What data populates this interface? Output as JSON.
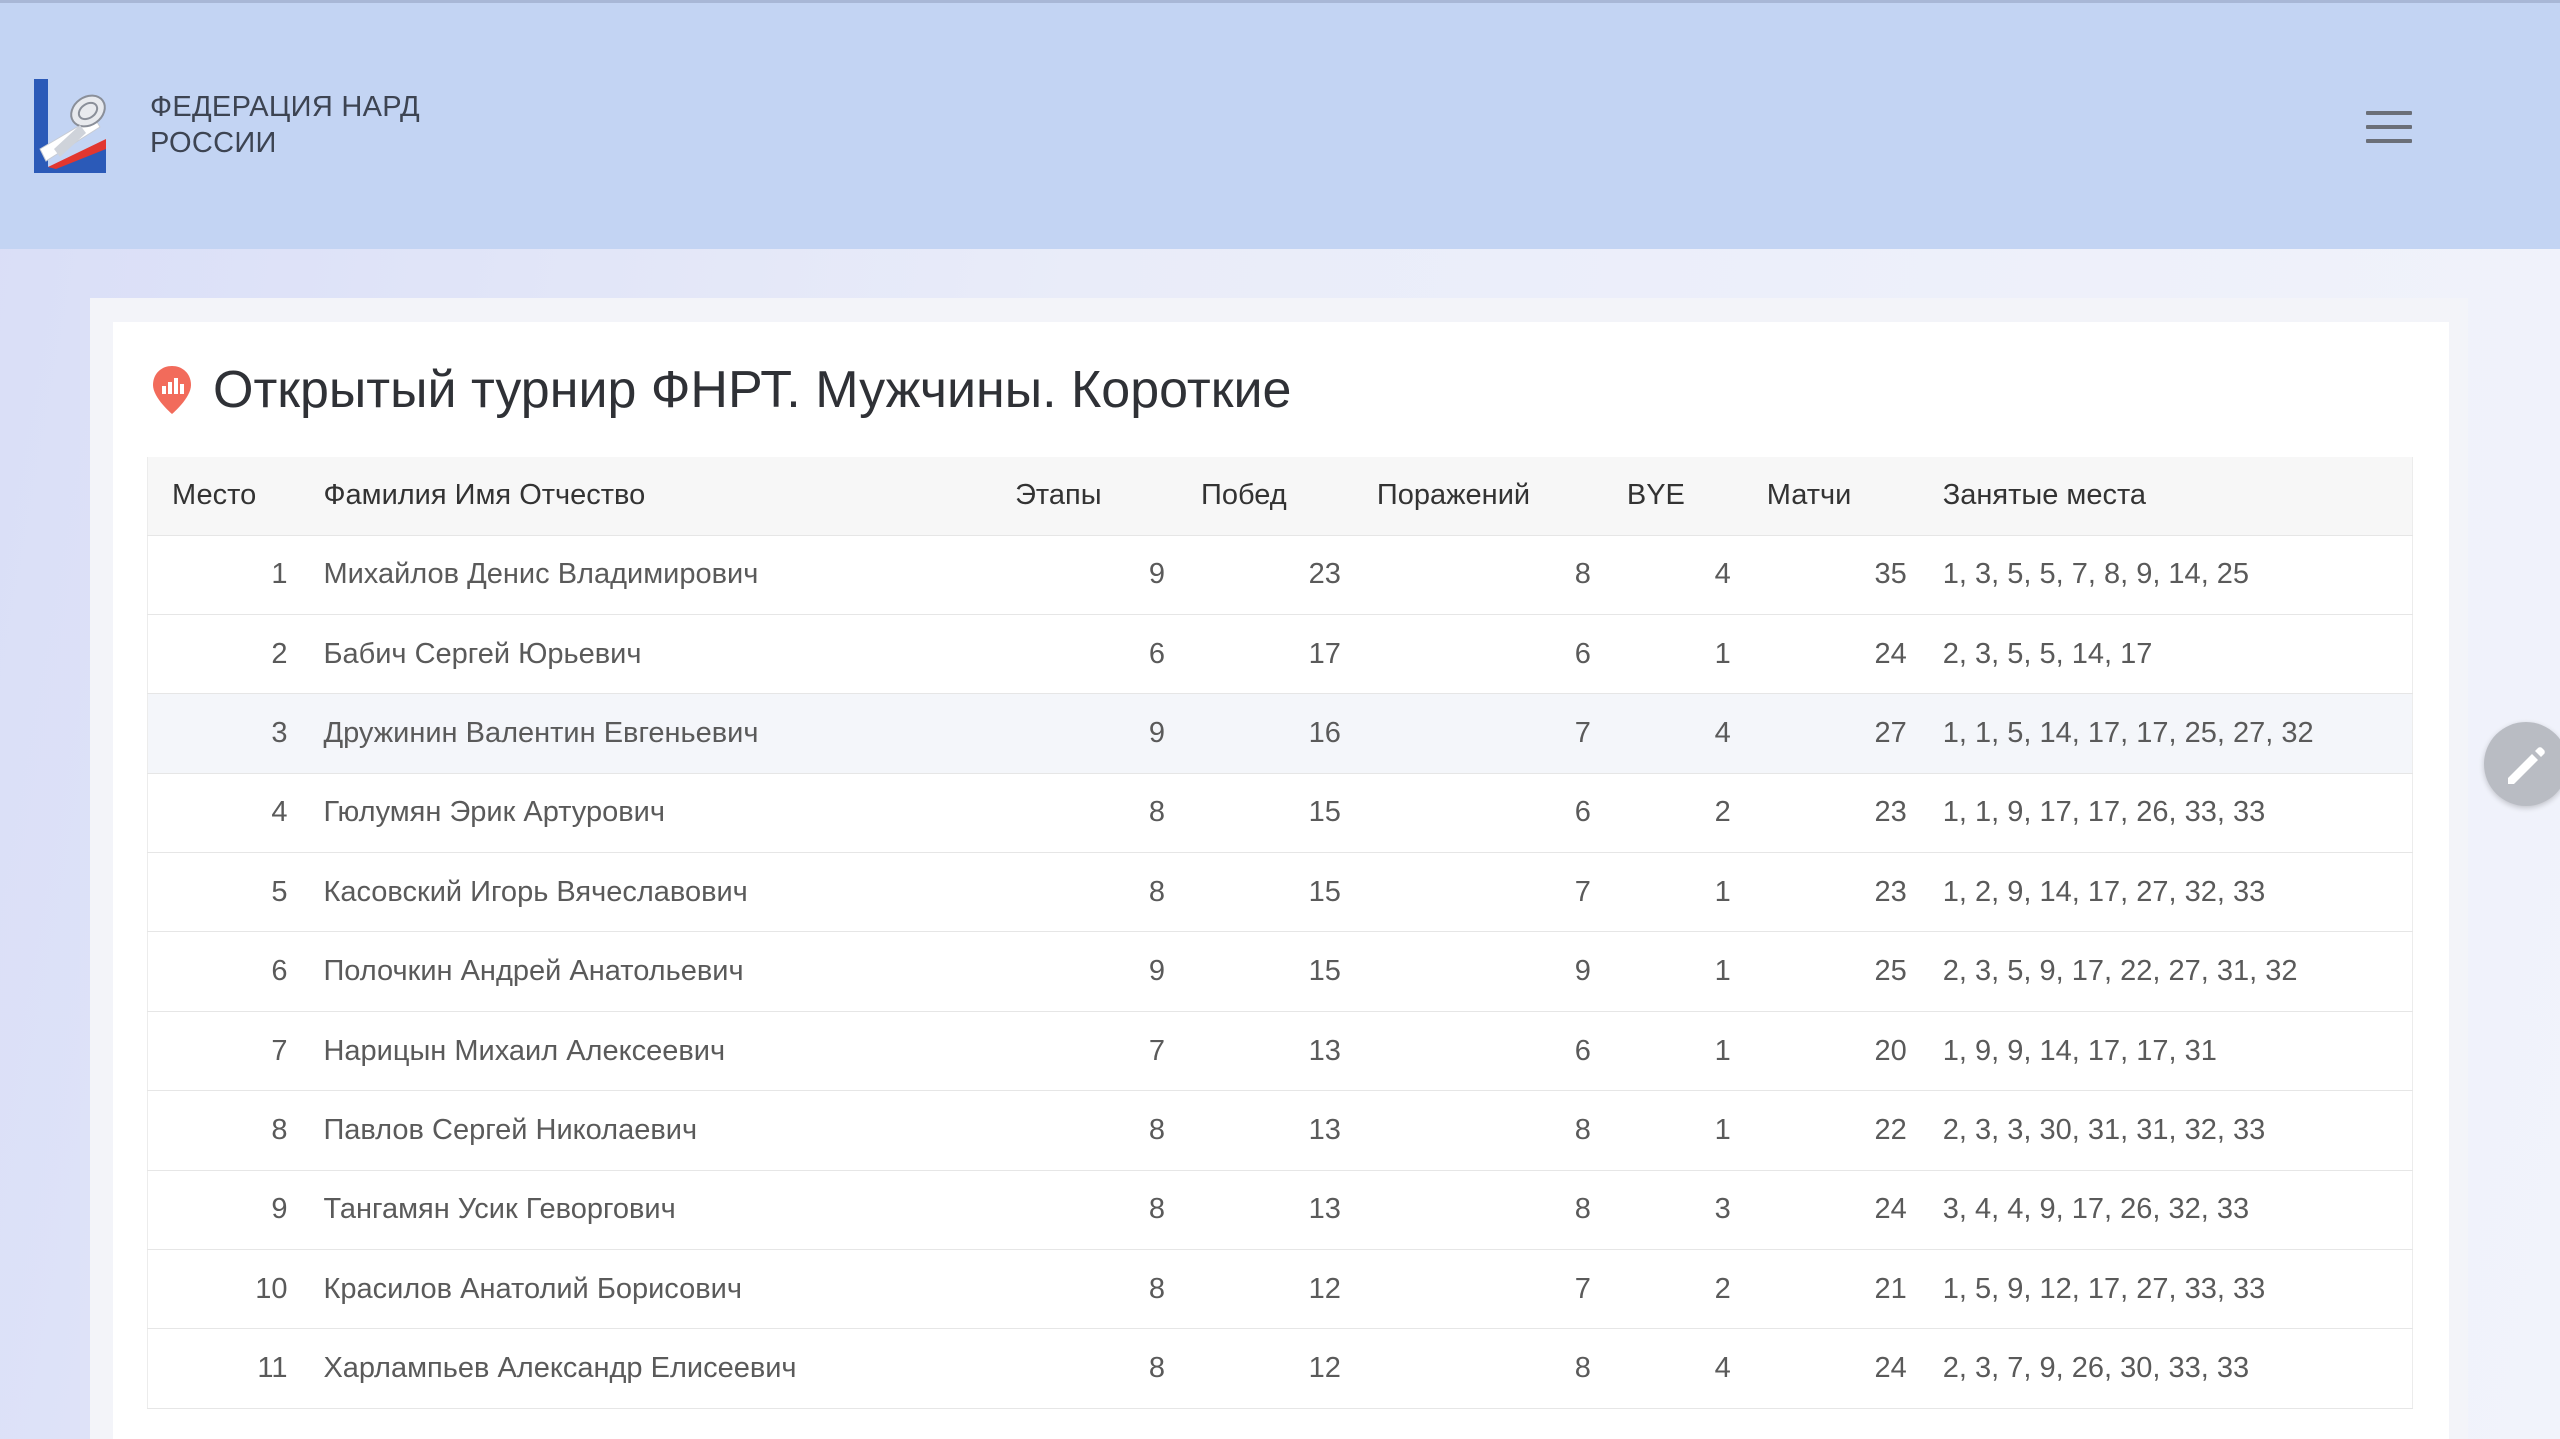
{
  "header": {
    "brand_line1": "ФЕДЕРАЦИЯ НАРД",
    "brand_line2": "РОССИИ"
  },
  "page": {
    "title": "Открытый турнир ФНРТ. Мужчины. Короткие"
  },
  "table": {
    "columns": [
      "Место",
      "Фамилия Имя Отчество",
      "Этапы",
      "Побед",
      "Поражений",
      "BYE",
      "Матчи",
      "Занятые места"
    ],
    "rows": [
      [
        "1",
        "Михайлов Денис Владимирович",
        "9",
        "23",
        "8",
        "4",
        "35",
        "1, 3, 5, 5, 7, 8, 9, 14, 25"
      ],
      [
        "2",
        "Бабич Сергей Юрьевич",
        "6",
        "17",
        "6",
        "1",
        "24",
        "2, 3, 5, 5, 14, 17"
      ],
      [
        "3",
        "Дружинин Валентин Евгеньевич",
        "9",
        "16",
        "7",
        "4",
        "27",
        "1, 1, 5, 14, 17, 17, 25, 27, 32"
      ],
      [
        "4",
        "Гюлумян Эрик Артурович",
        "8",
        "15",
        "6",
        "2",
        "23",
        "1, 1, 9, 17, 17, 26, 33, 33"
      ],
      [
        "5",
        "Касовский Игорь Вячеславович",
        "8",
        "15",
        "7",
        "1",
        "23",
        "1, 2, 9, 14, 17, 27, 32, 33"
      ],
      [
        "6",
        "Полочкин Андрей Анатольевич",
        "9",
        "15",
        "9",
        "1",
        "25",
        "2, 3, 5, 9, 17, 22, 27, 31, 32"
      ],
      [
        "7",
        "Нарицын Михаил Алексеевич",
        "7",
        "13",
        "6",
        "1",
        "20",
        "1, 9, 9, 14, 17, 17, 31"
      ],
      [
        "8",
        "Павлов Сергей Николаевич",
        "8",
        "13",
        "8",
        "1",
        "22",
        "2, 3, 3, 30, 31, 31, 32, 33"
      ],
      [
        "9",
        "Тангамян Усик Геворгович",
        "8",
        "13",
        "8",
        "3",
        "24",
        "3, 4, 4, 9, 17, 26, 32, 33"
      ],
      [
        "10",
        "Красилов Анатолий Борисович",
        "8",
        "12",
        "7",
        "2",
        "21",
        "1, 5, 9, 12, 17, 27, 33, 33"
      ],
      [
        "11",
        "Харлампьев Александр Елисеевич",
        "8",
        "12",
        "8",
        "4",
        "24",
        "2, 3, 7, 9, 26, 30, 33, 33"
      ]
    ],
    "highlighted_row": 3
  },
  "icons": {
    "logo": "federation-logo-icon",
    "menu": "hamburger-menu-icon",
    "title": "chart-pin-icon",
    "fab": "pencil-edit-icon"
  },
  "colors": {
    "header_bg": "#c3d4f3",
    "accent": "#f26b5b",
    "logo_blue": "#2b5ab8",
    "logo_red": "#e2362f"
  }
}
